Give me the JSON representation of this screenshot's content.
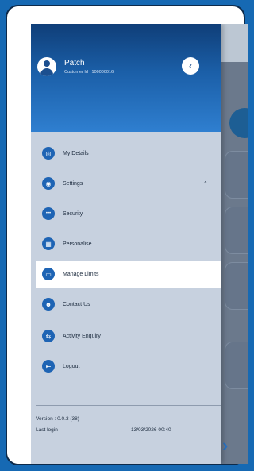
{
  "user": {
    "name": "Patch",
    "customer_id": "Customer Id : 100000016"
  },
  "icons": {
    "back": "chevron-left-icon"
  },
  "menu": [
    {
      "label": "My Details",
      "icon": "user-circle-icon",
      "glyph": "◎"
    },
    {
      "label": "Settings",
      "icon": "settings-icon",
      "glyph": "◉",
      "expanded": true
    },
    {
      "label": "Security",
      "icon": "password-icon",
      "glyph": "•••"
    },
    {
      "label": "Personalise",
      "icon": "grid-icon",
      "glyph": "▦"
    },
    {
      "label": "Manage Limits",
      "icon": "card-icon",
      "glyph": "▭",
      "active": true
    },
    {
      "label": "Contact Us",
      "icon": "people-icon",
      "glyph": "☻"
    },
    {
      "label": "Activity Enquiry",
      "icon": "swap-icon",
      "glyph": "⇆"
    },
    {
      "label": "Logout",
      "icon": "logout-icon",
      "glyph": "⇤"
    }
  ],
  "footer": {
    "version": "Version : 0.0.3 (38)",
    "last_login_label": "Last login",
    "last_login_value": "13/03/2026 00:40"
  },
  "colors": {
    "accent": "#1e64b4",
    "header_top": "#0f3e78",
    "header_bottom": "#2f7fd0",
    "page_background": "#1669b3"
  }
}
